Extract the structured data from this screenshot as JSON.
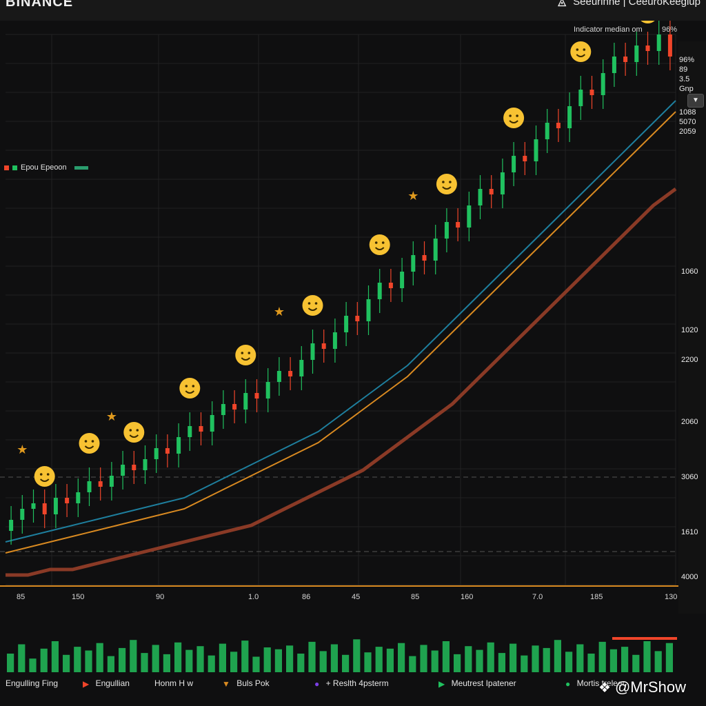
{
  "header": {
    "brand": "BINANCE",
    "right_text": "Seeurinne | CeeuroKeegiup"
  },
  "chart_info": {
    "indicator": "Indicator median om",
    "percent": "96%"
  },
  "legend_strip": {
    "label": "Epou Epeoon"
  },
  "right_panel": {
    "r1": "96%",
    "r2": "89",
    "r3": "3.5",
    "r4": "Gnp",
    "v1": "1088",
    "v2": "5070",
    "v3": "2059"
  },
  "price_labels": [
    "1060",
    "1020",
    "2200",
    "2060",
    "3060",
    "1610",
    "4000"
  ],
  "x_axis": [
    "85",
    "150",
    "90",
    "1.0",
    "86",
    "45",
    "85",
    "160",
    "7.0",
    "185",
    "130"
  ],
  "bottom_legend": [
    {
      "label": "Engulling Fing"
    },
    {
      "label": "Engullian"
    },
    {
      "label": "Honm H w"
    },
    {
      "label": "Buls Pok"
    },
    {
      "label": "+ Reslth 4psterm"
    },
    {
      "label": "Meutrest Ipatener"
    },
    {
      "label": "Mortis treleer"
    }
  ],
  "watermark": "@MrShow",
  "icons": [
    "binance-logo-icon",
    "chevron-down-icon",
    "emoji-icon",
    "star-icon",
    "diamond-logo-icon"
  ],
  "colors": {
    "bull": "#20c15f",
    "bear": "#f0452a",
    "ma_blue": "#1e7f9e",
    "ma_orange": "#d98a21",
    "ma_brown": "#8a3a26",
    "emoji": "#f7c232"
  },
  "chart_data": {
    "type": "candlestick",
    "x_ticks": [
      "85",
      "150",
      "90",
      "1.0",
      "86",
      "45",
      "85",
      "160",
      "7.0",
      "185",
      "130"
    ],
    "y_ticks": [
      "1060",
      "1020",
      "2200",
      "2060",
      "3060",
      "1610",
      "4000"
    ],
    "trend": "upward",
    "series": [
      {
        "role": "price",
        "values": [
          12,
          14,
          15,
          13,
          16,
          15,
          17,
          19,
          18,
          20,
          22,
          21,
          23,
          25,
          24,
          27,
          29,
          28,
          31,
          33,
          32,
          35,
          34,
          37,
          39,
          38,
          41,
          44,
          43,
          46,
          49,
          48,
          52,
          55,
          54,
          57,
          60,
          59,
          63,
          66,
          65,
          69,
          72,
          71,
          75,
          78,
          77,
          81,
          84,
          83,
          87,
          90,
          89,
          93,
          96,
          95,
          98,
          97,
          100,
          96
        ]
      },
      {
        "role": "ma_blue",
        "values": [
          8,
          9,
          10,
          11,
          12,
          13,
          14,
          15,
          16,
          18,
          20,
          22,
          24,
          26,
          28,
          31,
          34,
          37,
          40,
          44,
          48,
          52,
          56,
          60,
          64,
          68,
          72,
          76,
          80,
          84,
          88
        ]
      },
      {
        "role": "ma_orange",
        "values": [
          6,
          7,
          8,
          9,
          10,
          11,
          12,
          13,
          14,
          16,
          18,
          20,
          22,
          24,
          26,
          29,
          32,
          35,
          38,
          42,
          46,
          50,
          54,
          58,
          62,
          66,
          70,
          74,
          78,
          82,
          86
        ]
      },
      {
        "role": "ma_brown",
        "values": [
          2,
          2,
          3,
          3,
          4,
          5,
          6,
          7,
          8,
          9,
          10,
          11,
          13,
          15,
          17,
          19,
          21,
          24,
          27,
          30,
          33,
          37,
          41,
          45,
          49,
          53,
          57,
          61,
          65,
          69,
          72
        ]
      }
    ],
    "volume": [
      30,
      45,
      22,
      38,
      50,
      28,
      41,
      35,
      47,
      26,
      39,
      52,
      31,
      44,
      29,
      48,
      36,
      42,
      27,
      46,
      33,
      51,
      25,
      40,
      37,
      43,
      30,
      49,
      34,
      45,
      28,
      53,
      32,
      41,
      38,
      47,
      26,
      44,
      35,
      50,
      29,
      42,
      36,
      48,
      31,
      46,
      27,
      43,
      39,
      52,
      33,
      45,
      30,
      49,
      37,
      41,
      28,
      50,
      34,
      47
    ]
  }
}
